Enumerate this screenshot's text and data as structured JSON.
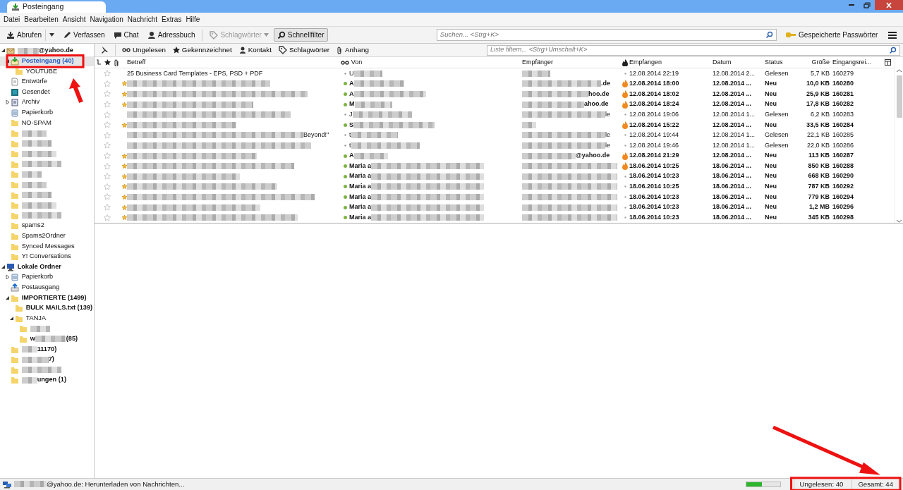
{
  "window": {
    "tab": "Posteingang"
  },
  "menu": [
    "Datei",
    "Bearbeiten",
    "Ansicht",
    "Navigation",
    "Nachricht",
    "Extras",
    "Hilfe"
  ],
  "toolbar": {
    "buttons": [
      {
        "kind": "get",
        "label": "Abrufen",
        "dropdown": true,
        "disabled": false,
        "selected": false
      },
      {
        "kind": "write",
        "label": "Verfassen",
        "disabled": false,
        "selected": false
      },
      {
        "kind": "chat",
        "label": "Chat",
        "disabled": false,
        "selected": false
      },
      {
        "kind": "contacts",
        "label": "Adressbuch",
        "disabled": false,
        "selected": false
      },
      {
        "kind": "tag",
        "label": "Schlagwörter",
        "dropdown": true,
        "disabled": true,
        "selected": false
      },
      {
        "kind": "filter",
        "label": "Schnellfilter",
        "disabled": false,
        "selected": true
      }
    ],
    "search": {
      "placeholder": "Suchen... <Strg+K>"
    },
    "passwords": "Gespeicherte Passwörter"
  },
  "sidebar": {
    "folders": [
      {
        "kind": "account",
        "label": "@yahoo.de",
        "redacted": true,
        "unread": true,
        "expanded": true,
        "children": [
          {
            "kind": "inbox",
            "label": "Posteingang (40)",
            "unread": true,
            "selected": true,
            "expanded": true,
            "children": [
              {
                "kind": "folder",
                "label": "YOUTUBE",
                "selected": false
              }
            ]
          },
          {
            "kind": "drafts",
            "label": "Entwürfe",
            "selected": false
          },
          {
            "kind": "sent",
            "label": "Gesendet",
            "selected": false
          },
          {
            "kind": "archive",
            "label": "Archiv",
            "selected": false,
            "expanded": false
          },
          {
            "kind": "trash",
            "label": "Papierkorb",
            "selected": false
          },
          {
            "kind": "folder",
            "label": "NO-SPAM",
            "selected": false
          },
          {
            "kind": "folder",
            "redacted": true,
            "selected": false
          },
          {
            "kind": "folder",
            "redacted": true,
            "selected": false
          },
          {
            "kind": "folder",
            "redacted": true,
            "selected": false
          },
          {
            "kind": "folder",
            "redacted": true,
            "selected": false
          },
          {
            "kind": "folder",
            "redacted": true,
            "selected": false
          },
          {
            "kind": "folder",
            "redacted": true,
            "selected": false
          },
          {
            "kind": "folder",
            "redacted": true,
            "selected": false
          },
          {
            "kind": "folder",
            "redacted": true,
            "selected": false
          },
          {
            "kind": "folder",
            "redacted": true,
            "selected": false
          },
          {
            "kind": "folder",
            "label": "spams2",
            "selected": false
          },
          {
            "kind": "folder",
            "label": "Spams2Ordner",
            "selected": false
          },
          {
            "kind": "folder",
            "label": "Synced Messages",
            "selected": false
          },
          {
            "kind": "folder",
            "label": "Y! Conversations",
            "selected": false
          }
        ]
      },
      {
        "kind": "local",
        "label": "Lokale Ordner",
        "unread": true,
        "expanded": true,
        "selected": false,
        "children": [
          {
            "kind": "trash",
            "label": "Papierkorb",
            "selected": false,
            "expanded": false
          },
          {
            "kind": "outbox",
            "label": "Postausgang",
            "selected": false
          },
          {
            "kind": "folder",
            "label": "IMPORTIERTE (1499)",
            "unread": true,
            "expanded": true,
            "selected": false,
            "children": [
              {
                "kind": "folder",
                "label": "BULK MAILS.txt (139)",
                "unread": true,
                "selected": false
              },
              {
                "kind": "folder",
                "label": "TANJA",
                "expanded": true,
                "selected": false,
                "children": [
                  {
                    "kind": "folder",
                    "redacted": true,
                    "selected": false
                  },
                  {
                    "kind": "folder",
                    "prefix": "w",
                    "label": "(85)",
                    "redacted": true,
                    "unread": true,
                    "selected": false
                  }
                ]
              }
            ]
          },
          {
            "kind": "folder",
            "label": "11170)",
            "redacted": true,
            "unread": true,
            "selected": false
          },
          {
            "kind": "folder",
            "label": "7)",
            "redacted": true,
            "unread": true,
            "selected": false
          },
          {
            "kind": "folder",
            "redacted": true,
            "selected": false
          },
          {
            "kind": "folder",
            "label": "ungen (1)",
            "redacted": true,
            "unread": true,
            "selected": false
          }
        ]
      }
    ]
  },
  "quickfilter": {
    "buttons": [
      {
        "kind": "pin",
        "selected": false
      },
      {
        "kind": "unread",
        "label": "Ungelesen",
        "selected": false
      },
      {
        "kind": "star",
        "label": "Gekennzeichnet",
        "selected": false
      },
      {
        "kind": "contact",
        "label": "Kontakt",
        "selected": false
      },
      {
        "kind": "tag",
        "label": "Schlagwörter",
        "selected": false
      },
      {
        "kind": "attach",
        "label": "Anhang",
        "selected": false
      }
    ],
    "filter": {
      "placeholder": "Liste filtern... <Strg+Umschalt+K>"
    }
  },
  "table": {
    "columns": [
      "Betreff",
      "Von",
      "Empfänger",
      "Empfangen",
      "Datum",
      "Status",
      "Größe",
      "Eingangsrei..."
    ],
    "rows": [
      {
        "subject": "25 Business Card Templates - EPS, PSD + PDF",
        "from": "U",
        "received": "12.08.2014 22:19",
        "date": "12.08.2014 2...",
        "status": "Gelesen",
        "size": "5,7 KB",
        "order": "160279",
        "unread": false,
        "new": false,
        "hot": false,
        "starred": false
      },
      {
        "subject_redacted": true,
        "from": "A",
        "recipient": ".de",
        "received": "12.08.2014 18:00",
        "date": "12.08.2014 ...",
        "status": "Neu",
        "size": "10,0 KB",
        "order": "160280",
        "unread": true,
        "new": true,
        "hot": true,
        "starred": false
      },
      {
        "subject_redacted": true,
        "from": "A",
        "recipient": "hoo.de",
        "received": "12.08.2014 18:02",
        "date": "12.08.2014 ...",
        "status": "Neu",
        "size": "25,9 KB",
        "order": "160281",
        "unread": true,
        "new": true,
        "hot": true,
        "starred": false
      },
      {
        "subject_redacted": true,
        "from": "M",
        "recipient": "ahoo.de",
        "received": "12.08.2014 18:24",
        "date": "12.08.2014 ...",
        "status": "Neu",
        "size": "17,8 KB",
        "order": "160282",
        "unread": true,
        "new": true,
        "hot": true,
        "starred": false
      },
      {
        "subject_redacted": true,
        "from": "J",
        "recipient": "le",
        "received": "12.08.2014 19:06",
        "date": "12.08.2014 1...",
        "status": "Gelesen",
        "size": "6,2 KB",
        "order": "160283",
        "unread": false,
        "new": false,
        "hot": false,
        "starred": false
      },
      {
        "subject_redacted": true,
        "from": "S",
        "received": "12.08.2014 15:22",
        "date": "12.08.2014 ...",
        "status": "Neu",
        "size": "33,5 KB",
        "order": "160284",
        "unread": true,
        "new": true,
        "hot": true,
        "starred": false
      },
      {
        "subject_redacted": true,
        "subject": "Beyond!\"",
        "from": "t",
        "recipient": "le",
        "received": "12.08.2014 19:44",
        "date": "12.08.2014 1...",
        "status": "Gelesen",
        "size": "22,1 KB",
        "order": "160285",
        "unread": false,
        "new": false,
        "hot": false,
        "starred": false
      },
      {
        "subject_redacted": true,
        "from": "t",
        "recipient": "le",
        "received": "12.08.2014 19:46",
        "date": "12.08.2014 1...",
        "status": "Gelesen",
        "size": "22,0 KB",
        "order": "160286",
        "unread": false,
        "new": false,
        "hot": false,
        "starred": false
      },
      {
        "subject_redacted": true,
        "from": "A",
        "recipient": "@yahoo.de",
        "received": "12.08.2014 21:29",
        "date": "12.08.2014 ...",
        "status": "Neu",
        "size": "113 KB",
        "order": "160287",
        "unread": true,
        "new": true,
        "hot": true,
        "starred": false
      },
      {
        "subject_redacted": true,
        "from": "Maria a",
        "received": "18.06.2014 10:25",
        "date": "18.06.2014 ...",
        "status": "Neu",
        "size": "850 KB",
        "order": "160288",
        "unread": true,
        "new": true,
        "hot": true,
        "starred": false
      },
      {
        "subject_redacted": true,
        "from": "Maria a",
        "received": "18.06.2014 10:23",
        "date": "18.06.2014 ...",
        "status": "Neu",
        "size": "668 KB",
        "order": "160290",
        "unread": true,
        "new": true,
        "hot": false,
        "starred": false
      },
      {
        "subject_redacted": true,
        "from": "Maria a",
        "received": "18.06.2014 10:25",
        "date": "18.06.2014 ...",
        "status": "Neu",
        "size": "787 KB",
        "order": "160292",
        "unread": true,
        "new": true,
        "hot": false,
        "starred": false
      },
      {
        "subject_redacted": true,
        "from": "Maria a",
        "received": "18.06.2014 10:23",
        "date": "18.06.2014 ...",
        "status": "Neu",
        "size": "779 KB",
        "order": "160294",
        "unread": true,
        "new": true,
        "hot": false,
        "starred": false
      },
      {
        "subject_redacted": true,
        "from": "Maria a",
        "received": "18.06.2014 10:23",
        "date": "18.06.2014 ...",
        "status": "Neu",
        "size": "1,2 MB",
        "order": "160296",
        "unread": true,
        "new": true,
        "hot": false,
        "starred": false
      },
      {
        "subject_redacted": true,
        "from": "Maria a",
        "received": "18.06.2014 10:23",
        "date": "18.06.2014 ...",
        "status": "Neu",
        "size": "345 KB",
        "order": "160298",
        "unread": true,
        "new": true,
        "hot": false,
        "starred": false
      }
    ]
  },
  "statusbar": {
    "message": "@yahoo.de: Herunterladen von Nachrichten...",
    "redacted": true,
    "progress": {
      "level": 0.46
    },
    "unread": "Ungelesen: 40",
    "total": "Gesamt: 44"
  }
}
